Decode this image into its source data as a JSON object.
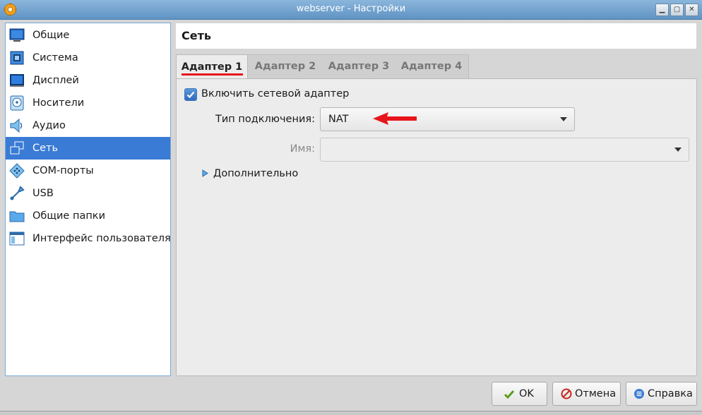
{
  "window": {
    "title": "webserver - Настройки",
    "controls": [
      "minimize-icon",
      "maximize-icon",
      "close-icon"
    ]
  },
  "sidebar": {
    "items": [
      {
        "label": "Общие",
        "icon": "monitor-icon",
        "selected": false
      },
      {
        "label": "Система",
        "icon": "chip-icon",
        "selected": false
      },
      {
        "label": "Дисплей",
        "icon": "display-icon",
        "selected": false
      },
      {
        "label": "Носители",
        "icon": "disk-icon",
        "selected": false
      },
      {
        "label": "Аудио",
        "icon": "speaker-icon",
        "selected": false
      },
      {
        "label": "Сеть",
        "icon": "network-icon",
        "selected": true
      },
      {
        "label": "COM-порты",
        "icon": "serial-port-icon",
        "selected": false
      },
      {
        "label": "USB",
        "icon": "usb-icon",
        "selected": false
      },
      {
        "label": "Общие папки",
        "icon": "folder-icon",
        "selected": false
      },
      {
        "label": "Интерфейс пользователя",
        "icon": "window-ui-icon",
        "selected": false
      }
    ]
  },
  "page": {
    "title": "Сеть"
  },
  "tabs": [
    {
      "label": "Адаптер 1",
      "active": true
    },
    {
      "label": "Адаптер 2",
      "active": false
    },
    {
      "label": "Адаптер 3",
      "active": false
    },
    {
      "label": "Адаптер 4",
      "active": false
    }
  ],
  "adapter": {
    "enable_label": "Включить сетевой адаптер",
    "enable_checked": true,
    "attachment_label": "Тип подключения:",
    "attachment_value": "NAT",
    "name_label": "Имя:",
    "name_value": "",
    "advanced_label": "Дополнительно"
  },
  "buttons": {
    "ok": "OK",
    "cancel": "Отмена",
    "help": "Справка"
  },
  "colors": {
    "accent": "#3a7bd5",
    "annotation": "#e8141b"
  }
}
